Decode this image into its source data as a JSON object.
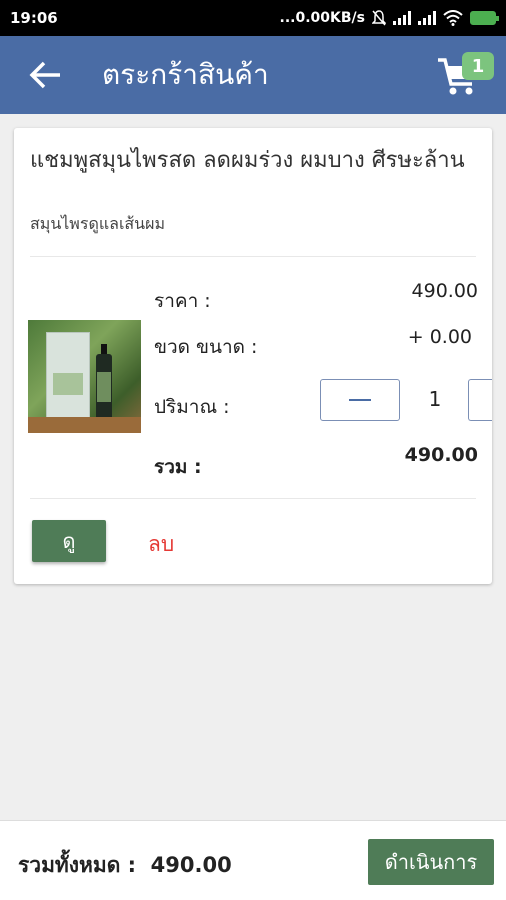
{
  "status_bar": {
    "time": "19:06",
    "network_speed": "...0.00KB/s",
    "icons": [
      "mute-icon",
      "signal-icon",
      "signal-icon",
      "wifi-icon",
      "battery-charging-icon"
    ]
  },
  "app_bar": {
    "back_icon": "arrow-left-icon",
    "title": "ตระกร้าสินค้า",
    "cart_icon": "cart-icon",
    "cart_count": "1"
  },
  "cart_item": {
    "name": "แชมพูสมุนไพรสด ลดผมร่วง ผมบาง ศีรษะล้าน",
    "category": "สมุนไพรดูแลเส้นผม",
    "price_label": "ราคา :",
    "price_value": "490.00",
    "size_label": "ขวด ขนาด :",
    "size_value": "+ 0.00",
    "qty_label": "ปริมาณ :",
    "qty_value": "1",
    "subtotal_label": "รวม :",
    "subtotal_value": "490.00",
    "view_button": "ดู",
    "delete_link": "ลบ"
  },
  "footer": {
    "total_label": "รวมทั้งหมด :",
    "total_value": "490.00",
    "checkout_button": "ดำเนินการ"
  },
  "colors": {
    "app_bar": "#4a6ca5",
    "button_green": "#4f7c57",
    "badge_green": "#7cc47e",
    "delete_red": "#e53935"
  }
}
